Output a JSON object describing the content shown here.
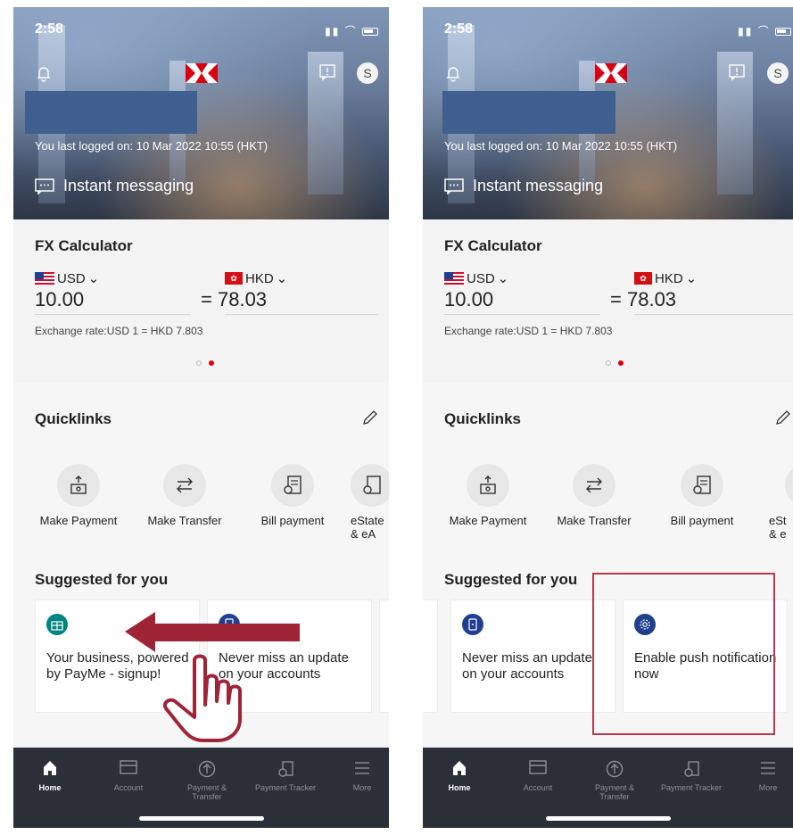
{
  "status_bar": {
    "time": "2:58"
  },
  "header": {
    "avatar_initial": "S",
    "last_login": "You last logged on: 10 Mar 2022 10:55 (HKT)",
    "instant_messaging": "Instant messaging"
  },
  "fx": {
    "title": "FX Calculator",
    "from_currency": "USD",
    "to_currency": "HKD",
    "from_amount": "10.00",
    "equals": "=",
    "to_amount": "78.03",
    "rate": "Exchange rate:USD 1 = HKD 7.803",
    "carousel_active_index": 1
  },
  "quicklinks": {
    "title": "Quicklinks",
    "items": [
      {
        "label": "Make Payment",
        "icon": "payment-icon"
      },
      {
        "label": "Make Transfer",
        "icon": "transfer-icon"
      },
      {
        "label": "Bill payment",
        "icon": "bill-icon"
      },
      {
        "label": "eStatement & eAdvice",
        "icon": "estatement-icon"
      }
    ],
    "left_partial": [
      "eState",
      "& eA"
    ],
    "right_partial": [
      "eSt",
      "& e"
    ]
  },
  "suggested": {
    "title": "Suggested for you",
    "left_cards": [
      {
        "text": "Your business, powered by PayMe - signup!",
        "icon": "payme-icon",
        "color": "#00847f"
      },
      {
        "text": "Never miss an update on your accounts",
        "icon": "phone-alert-icon",
        "color": "#1f3f8f"
      },
      {
        "text": "E n",
        "icon": "partial-icon",
        "color": "#1f3f8f"
      }
    ],
    "right_cards": [
      {
        "text": "Never miss an update on your accounts",
        "icon": "phone-alert-icon",
        "color": "#1f3f8f"
      },
      {
        "text": "Enable push notification now",
        "icon": "gear-icon",
        "color": "#1f3f8f"
      }
    ]
  },
  "nav": {
    "items": [
      {
        "label": "Home",
        "icon": "home-icon"
      },
      {
        "label": "Account",
        "icon": "card-icon"
      },
      {
        "label": "Payment & Transfer",
        "icon": "arrow-up-circle-icon"
      },
      {
        "label": "Payment Tracker",
        "icon": "tracker-icon"
      },
      {
        "label": "More",
        "icon": "menu-icon"
      }
    ]
  },
  "colors": {
    "brand_red": "#db0011",
    "nav_bg": "#2b2f38",
    "swipe_arrow": "#9e2436",
    "highlight_border": "#b53a4c"
  }
}
